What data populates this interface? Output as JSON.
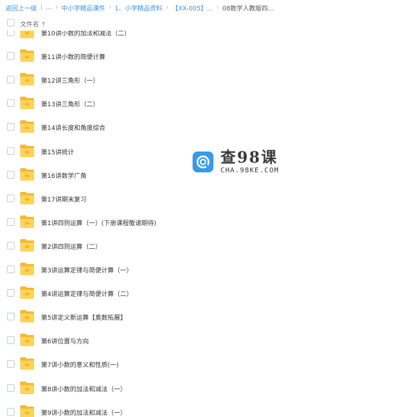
{
  "breadcrumb": {
    "back_label": "返回上一级",
    "sep": "|",
    "crumbs": [
      "...",
      "中小学精品课件",
      "1、小学精品资料",
      "【XX-005】...",
      "08数学人教版四..."
    ]
  },
  "header": {
    "column_name": "文件名",
    "sort_icon": "↑"
  },
  "files": [
    "第10讲小数的加法和减法（二）",
    "第11讲小数的简便计算",
    "第12讲三角形（一）",
    "第13讲三角形（二）",
    "第14讲长度和角度综合",
    "第15讲统计",
    "第16讲数学广角",
    "第17讲期末复习",
    "第1讲四则运算（一）(下册课程敬请期待)",
    "第2讲四则运算（二）",
    "第3讲运算定律与简便计算（一）",
    "第4讲运算定律与简便计算（二）",
    "第5讲定义新运算【奥数拓展】",
    "第6讲位置与方向",
    "第7讲小数的意义和性质(一)",
    "第8讲小数的加法和减法（一）",
    "第9讲小数的加法和减法（一）"
  ],
  "icons": {
    "folder": "folder-icon",
    "watermark_logo": "magnifier-logo-icon"
  },
  "colors": {
    "accent": "#3a8ee6",
    "folder": "#fdd35a",
    "folder_dark": "#f4b92e",
    "logo": "#3a9ae8"
  },
  "watermark": {
    "title": "查98课",
    "subtitle": "CHA.98KE.COM"
  }
}
